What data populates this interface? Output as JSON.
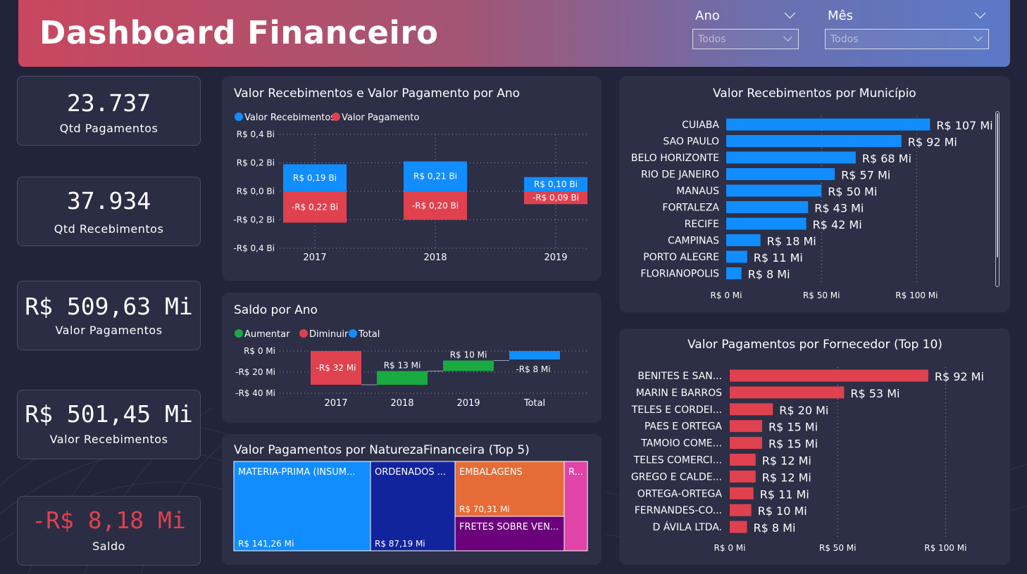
{
  "header": {
    "title": "Dashboard Financeiro"
  },
  "filters": {
    "ano": {
      "label": "Ano",
      "value": "Todos"
    },
    "mes": {
      "label": "Mês",
      "value": "Todos"
    }
  },
  "kpis": [
    {
      "value": "23.737",
      "label": "Qtd Pagamentos"
    },
    {
      "value": "37.934",
      "label": "Qtd Recebimentos"
    },
    {
      "value": "R$ 509,63 Mi",
      "label": "Valor Pagamentos"
    },
    {
      "value": "R$ 501,45 Mi",
      "label": "Valor Recebimentos"
    },
    {
      "value": "-R$ 8,18 Mi",
      "label": "Saldo",
      "color": "#e0414f"
    }
  ],
  "chart_data": [
    {
      "id": "rec_pag_ano",
      "type": "bar",
      "title": "Valor Recebimentos e Valor Pagamento por Ano",
      "categories": [
        "2017",
        "2018",
        "2019"
      ],
      "series": [
        {
          "name": "Valor Recebimentos",
          "values": [
            0.19,
            0.21,
            0.1
          ],
          "labels": [
            "R$ 0,19 Bi",
            "R$ 0,21 Bi",
            "R$ 0,10 Bi"
          ],
          "color": "#118dff"
        },
        {
          "name": "Valor Pagamento",
          "values": [
            -0.22,
            -0.2,
            -0.09
          ],
          "labels": [
            "-R$ 0,22 Bi",
            "-R$ 0,20 Bi",
            "-R$ 0,09 Bi"
          ],
          "color": "#e0414f"
        }
      ],
      "yticks": [
        "R$ 0,4 Bi",
        "R$ 0,2 Bi",
        "R$ 0,0 Bi",
        "-R$ 0,2 Bi",
        "-R$ 0,4 Bi"
      ],
      "ylim": [
        -0.4,
        0.4
      ],
      "grid": true,
      "legend": "top-left"
    },
    {
      "id": "saldo_ano",
      "type": "bar",
      "subtype": "waterfall",
      "title": "Saldo por Ano",
      "legend_items": [
        {
          "name": "Aumentar",
          "color": "#1aab40"
        },
        {
          "name": "Diminuir",
          "color": "#e0414f"
        },
        {
          "name": "Total",
          "color": "#118dff"
        }
      ],
      "categories": [
        "2017",
        "2018",
        "2019",
        "Total"
      ],
      "values": [
        -32,
        13,
        10,
        -8
      ],
      "labels": [
        "-R$ 32 Mi",
        "R$ 13 Mi",
        "R$ 10 Mi",
        "-R$ 8 Mi"
      ],
      "yticks": [
        "R$ 0 Mi",
        "-R$ 20 Mi",
        "-R$ 40 Mi"
      ],
      "ylim": [
        -40,
        0
      ],
      "grid": true,
      "legend": "top-left"
    },
    {
      "id": "natureza",
      "type": "treemap",
      "title": "Valor Pagamentos por NaturezaFinanceira (Top 5)",
      "items": [
        {
          "name": "MATERIA-PRIMA (INSUM...",
          "label": "R$ 141,26 Mi",
          "value": 141.26,
          "color": "#118dff"
        },
        {
          "name": "ORDENADOS ...",
          "label": "R$ 87,19 Mi",
          "value": 87.19,
          "color": "#12239e"
        },
        {
          "name": "EMBALAGENS",
          "label": "R$ 70,31 Mi",
          "value": 70.31,
          "color": "#e66c37"
        },
        {
          "name": "FRETES SOBRE VEN...",
          "label": "",
          "color": "#6b007b"
        },
        {
          "name": "R...",
          "label": "",
          "color": "#e044a7"
        }
      ]
    },
    {
      "id": "municipio",
      "type": "bar",
      "orientation": "horizontal",
      "title": "Valor Recebimentos por Município",
      "categories": [
        "CUIABA",
        "SAO PAULO",
        "BELO HORIZONTE",
        "RIO DE JANEIRO",
        "MANAUS",
        "FORTALEZA",
        "RECIFE",
        "CAMPINAS",
        "PORTO ALEGRE",
        "FLORIANOPOLIS"
      ],
      "values": [
        107,
        92,
        68,
        57,
        50,
        43,
        42,
        18,
        11,
        8
      ],
      "labels": [
        "R$ 107 Mi",
        "R$ 92 Mi",
        "R$ 68 Mi",
        "R$ 57 Mi",
        "R$ 50 Mi",
        "R$ 43 Mi",
        "R$ 42 Mi",
        "R$ 18 Mi",
        "R$ 11 Mi",
        "R$ 8 Mi"
      ],
      "xticks": [
        "R$ 0 Mi",
        "R$ 50 Mi",
        "R$ 100 Mi"
      ],
      "xlim": [
        0,
        125
      ],
      "color": "#118dff"
    },
    {
      "id": "fornecedor",
      "type": "bar",
      "orientation": "horizontal",
      "title": "Valor Pagamentos por Fornecedor (Top 10)",
      "categories": [
        "BENITES E SAN...",
        "MARIN E BARROS",
        "TELES E CORDEI...",
        "PAES E ORTEGA",
        "TAMOIO COME...",
        "TELES COMERCI...",
        "GREGO E CALDE...",
        "ORTEGA-ORTEGA",
        "FERNANDES-CO...",
        "D ÁVILA LTDA."
      ],
      "values": [
        92,
        53,
        20,
        15,
        15,
        12,
        12,
        11,
        10,
        8
      ],
      "labels": [
        "R$ 92 Mi",
        "R$ 53 Mi",
        "R$ 20 Mi",
        "R$ 15 Mi",
        "R$ 15 Mi",
        "R$ 12 Mi",
        "R$ 12 Mi",
        "R$ 11 Mi",
        "R$ 10 Mi",
        "R$ 8 Mi"
      ],
      "xticks": [
        "R$ 0 Mi",
        "R$ 50 Mi",
        "R$ 100 Mi"
      ],
      "xlim": [
        0,
        110
      ],
      "color": "#e0414f"
    }
  ]
}
